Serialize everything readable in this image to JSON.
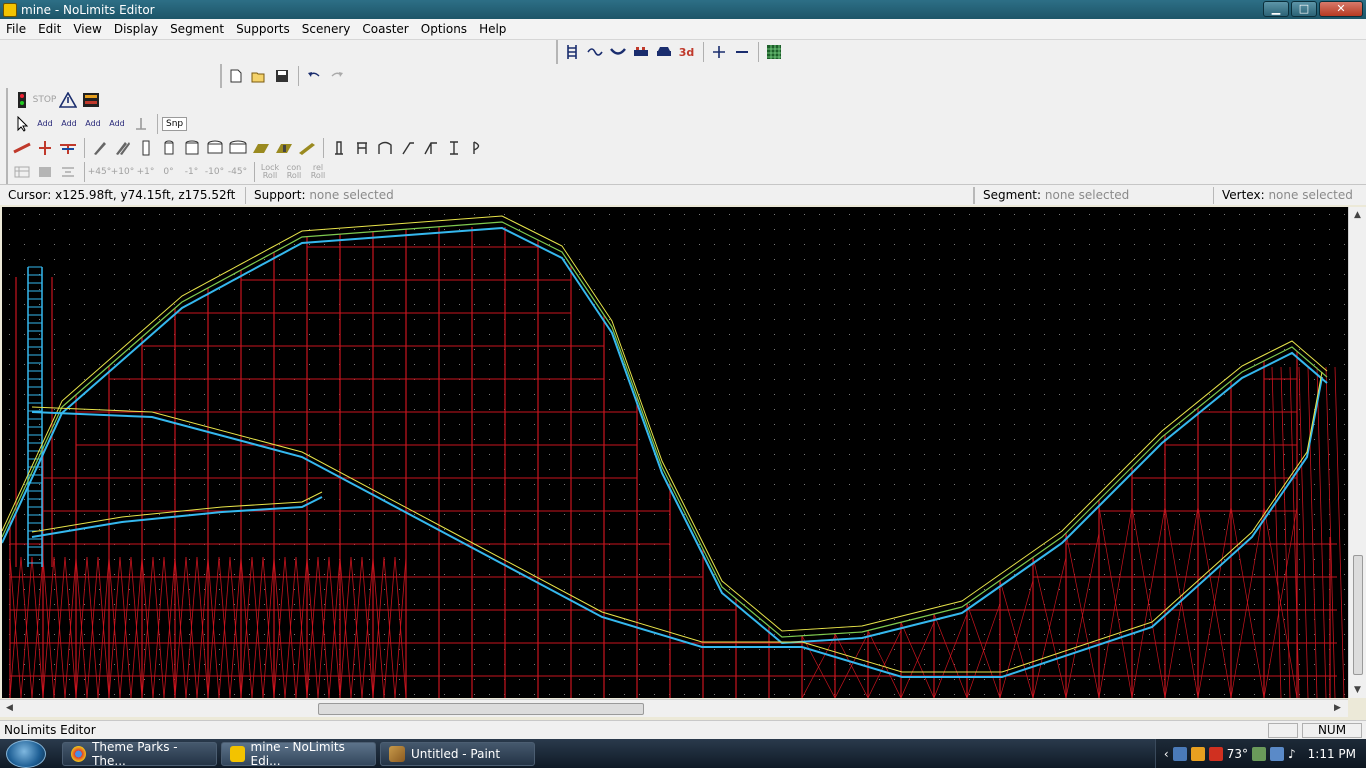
{
  "window": {
    "title": "mine - NoLimits Editor",
    "minimize": "▁",
    "maximize": "□",
    "close": "✕"
  },
  "menu": [
    "File",
    "Edit",
    "View",
    "Display",
    "Segment",
    "Supports",
    "Scenery",
    "Coaster",
    "Options",
    "Help"
  ],
  "toolbar_view": {
    "icons": [
      "track-view",
      "curve-view",
      "wave-view",
      "train-view",
      "train-front-view",
      "3d-view",
      "zoom-in",
      "zoom-out",
      "grid-icon"
    ],
    "label_3d": "3d"
  },
  "toolbar_file": {
    "icons": [
      "new-icon",
      "open-icon",
      "save-icon",
      "undo-icon",
      "redo-icon"
    ]
  },
  "toolbar_sim": {
    "stop_label": "STOP",
    "icons": [
      "signal-icon",
      "stop-icon",
      "warning-icon",
      "train-icon"
    ]
  },
  "toolbar_add": {
    "labels": [
      "Add",
      "Add",
      "Add",
      "Add"
    ],
    "snap_label": "Snp"
  },
  "toolbar_support_labels": [
    "+45°",
    "+10°",
    "+1°",
    "0°",
    "-1°",
    "-10°",
    "-45°"
  ],
  "toolbar_roll_labels": [
    "Lock\nRoll",
    "con\nRoll",
    "rel\nRoll"
  ],
  "info": {
    "cursor_label": "Cursor:",
    "cursor_value": "x125.98ft, y74.15ft, z175.52ft",
    "support_label": "Support:",
    "support_value": "none selected",
    "segment_label": "Segment:",
    "segment_value": "none selected",
    "vertex_label": "Vertex:",
    "vertex_value": "none selected"
  },
  "colors": {
    "structure": "#c8141e",
    "track_cyan": "#35b8ee",
    "track_yellow": "#e7e34a",
    "track_green": "#7ec94f",
    "background": "#000000"
  },
  "status": {
    "text": "NoLimits Editor",
    "num": "NUM"
  },
  "taskbar": {
    "tasks": [
      {
        "label": "Theme Parks - The...",
        "icon": "chrome-icon"
      },
      {
        "label": "mine - NoLimits Edi...",
        "icon": "nolimits-icon"
      },
      {
        "label": "Untitled - Paint",
        "icon": "paint-icon"
      }
    ],
    "temp": "73°",
    "clock": "1:11 PM"
  }
}
